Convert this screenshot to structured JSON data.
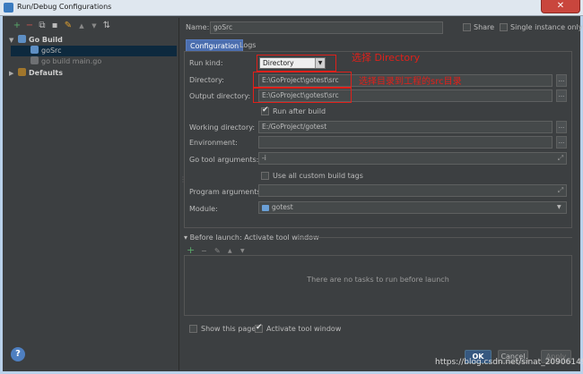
{
  "window": {
    "title": "Run/Debug Configurations",
    "close_glyph": "✕"
  },
  "toolbar": {
    "add": "+",
    "remove": "−",
    "copy": "⧉",
    "save": "▪",
    "settings": "✎",
    "up": "▲",
    "down": "▼",
    "sort": "⇅"
  },
  "tree": {
    "go_build": {
      "label": "Go Build",
      "arrow": "▼"
    },
    "items": [
      {
        "label": "goSrc"
      },
      {
        "label": "go build main.go"
      }
    ],
    "defaults": {
      "label": "Defaults",
      "arrow": "▶"
    }
  },
  "form": {
    "name_label": "Name:",
    "name_value": "goSrc",
    "share_label": "Share",
    "single_instance_label": "Single instance only",
    "tabs": [
      {
        "label": "Configuration"
      },
      {
        "label": "Logs"
      }
    ],
    "run_kind_label": "Run kind:",
    "run_kind_value": "Directory",
    "directory_label": "Directory:",
    "directory_value": "E:\\GoProject\\gotest\\src",
    "output_label": "Output directory:",
    "output_value": "E:\\GoProject\\gotest\\src",
    "run_after_build_label": "Run after build",
    "working_label": "Working directory:",
    "working_value": "E:/GoProject/gotest",
    "environment_label": "Environment:",
    "go_tool_label": "Go tool arguments:",
    "go_tool_value": "-i",
    "custom_tags_label": "Use all custom build tags",
    "program_label": "Program arguments:",
    "module_label": "Module:",
    "module_value": "gotest",
    "browse_glyph": "...",
    "expand_glyph": "⤢"
  },
  "annotations": {
    "directory": "选择 Directory",
    "src": "选择目录到工程的src目录"
  },
  "before_launch": {
    "title": "Before launch: Activate tool window",
    "empty": "There are no tasks to run before launch",
    "tools": {
      "add": "+",
      "remove": "−",
      "edit": "✎",
      "up": "▲",
      "down": "▼"
    }
  },
  "bottom": {
    "show_page_label": "Show this page",
    "activate_label": "Activate tool window",
    "ok": "OK",
    "cancel": "Cancel",
    "apply": "Apply",
    "help": "?"
  },
  "watermark": "https://blog.csdn.net/sinat_20906149",
  "colors": {
    "accent": "#4b6eaf",
    "annotation_red": "#e0201a",
    "background": "#3c3f41"
  }
}
